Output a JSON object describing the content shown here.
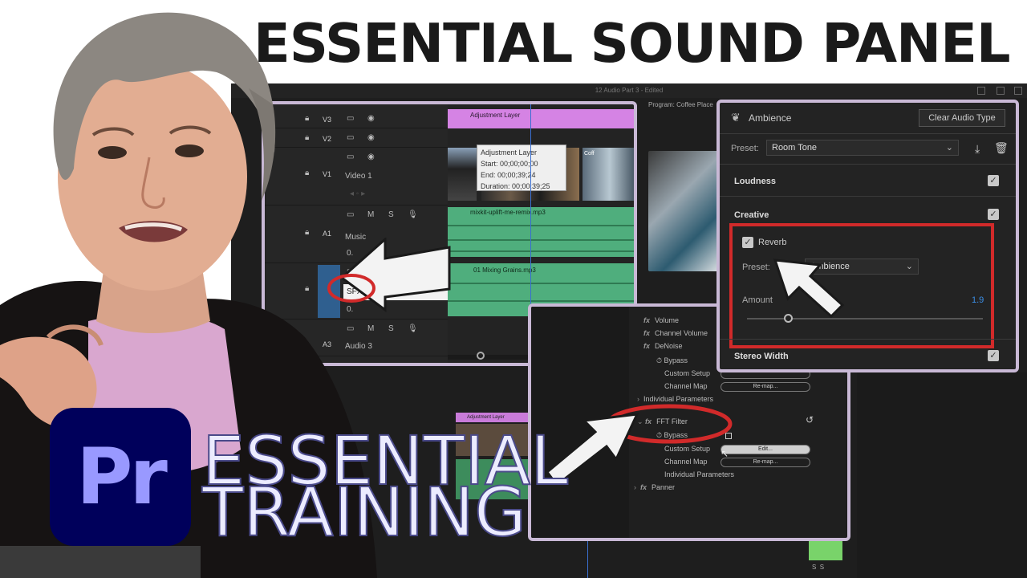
{
  "headline": "ESSENTIAL SOUND PANEL",
  "workspace": {
    "window_title": "12 Audio Part 3",
    "window_status": "Edited",
    "program_monitor": "Program: Coffee Place",
    "bottom_clip": "Adjustment Layer"
  },
  "timeline": {
    "tracks": [
      {
        "id": "V3",
        "name": ""
      },
      {
        "id": "V2",
        "name": ""
      },
      {
        "id": "V1",
        "name": "Video 1"
      },
      {
        "id": "A1",
        "name": "Music"
      },
      {
        "id": "A2",
        "name": "SFX"
      },
      {
        "id": "A3",
        "name": "Audio 3"
      }
    ],
    "track_buttons": {
      "mute": "M",
      "solo": "S",
      "zero": "0."
    },
    "adjustment_clip": "Adjustment Layer",
    "video_clip_label": "Coff",
    "music_clip": "mixkit-uplift-me-remix.mp3",
    "sfx_clip": "01 Mixing Grains.mp3",
    "tooltip": {
      "title": "Adjustment Layer",
      "start": "Start: 00;00;00;00",
      "end": "End: 00;00;39;24",
      "duration": "Duration: 00;00;39;25"
    }
  },
  "effects": {
    "items": [
      "Volume",
      "Channel Volume",
      "DeNoise"
    ],
    "denoise_sub": [
      "Bypass",
      "Custom Setup",
      "Channel Map",
      "Individual Parameters"
    ],
    "fft_filter": "FFT Filter",
    "fft_sub": [
      "Bypass",
      "Custom Setup",
      "Channel Map",
      "Individual Parameters"
    ],
    "panner": "Panner",
    "remap_label": "Re-map...",
    "edit_label": "Edit..."
  },
  "essential_sound": {
    "audio_type": "Ambience",
    "clear_button": "Clear Audio Type",
    "preset_label": "Preset:",
    "preset_value": "Room Tone",
    "sections": [
      "Loudness",
      "Creative",
      "Stereo Width"
    ],
    "reverb": {
      "label": "Reverb",
      "preset_label": "Preset:",
      "preset_value": "Ambience",
      "amount_label": "Amount",
      "amount_value": "1.9"
    }
  },
  "branding": {
    "logo_text": "Pr",
    "title_line1": "ESSENTIAL",
    "title_line2": "TRAINING"
  },
  "colors": {
    "adjustment_clip": "#d583e4",
    "audio_clip": "#4fae7d",
    "highlight_red": "#d12a2a",
    "panel_border": "#c9b9d6",
    "pr_bg": "#00005b",
    "pr_text": "#9999ff",
    "value_blue": "#3a8ee6"
  }
}
